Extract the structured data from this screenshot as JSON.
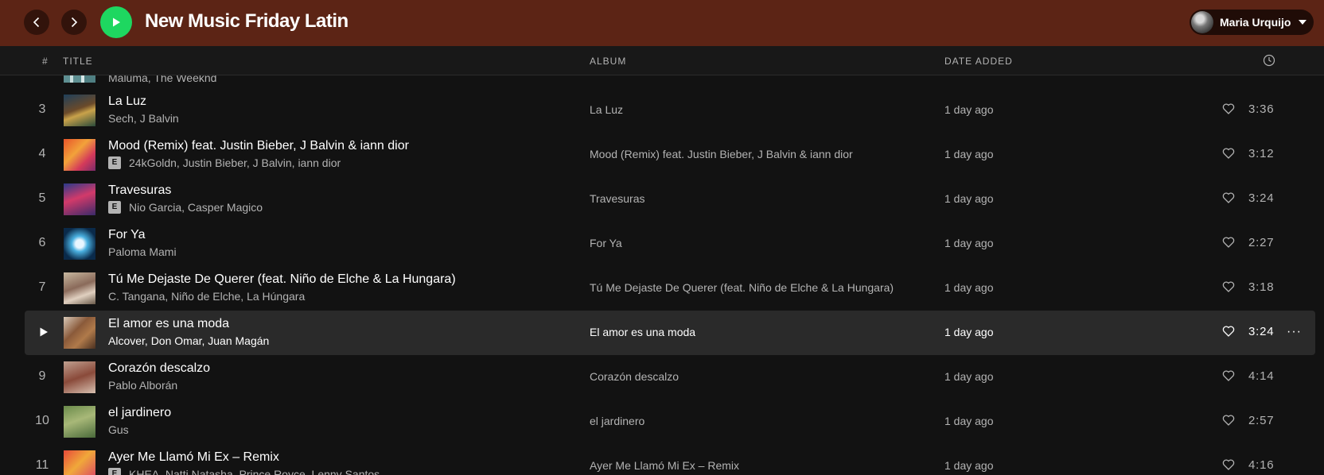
{
  "topbar": {
    "playlist_title": "New Music Friday Latin",
    "user_name": "Maria Urquijo"
  },
  "header": {
    "num": "#",
    "title": "TITLE",
    "album": "ALBUM",
    "date_added": "DATE ADDED"
  },
  "partial_row": {
    "artists": "Maluma, The Weeknd"
  },
  "tracks": [
    {
      "num": "3",
      "title": "La Luz",
      "artists": "Sech, J Balvin",
      "explicit": false,
      "album": "La Luz",
      "date": "1 day ago",
      "duration": "3:36"
    },
    {
      "num": "4",
      "title": "Mood (Remix) feat. Justin Bieber, J Balvin & iann dior",
      "artists": "24kGoldn, Justin Bieber, J Balvin, iann dior",
      "explicit": true,
      "explicit_label": "E",
      "album": "Mood (Remix) feat. Justin Bieber, J Balvin & iann dior",
      "date": "1 day ago",
      "duration": "3:12"
    },
    {
      "num": "5",
      "title": "Travesuras",
      "artists": "Nio Garcia, Casper Magico",
      "explicit": true,
      "explicit_label": "E",
      "album": "Travesuras",
      "date": "1 day ago",
      "duration": "3:24"
    },
    {
      "num": "6",
      "title": "For Ya",
      "artists": "Paloma Mami",
      "explicit": false,
      "album": "For Ya",
      "date": "1 day ago",
      "duration": "2:27"
    },
    {
      "num": "7",
      "title": "Tú Me Dejaste De Querer (feat. Niño de Elche & La Hungara)",
      "artists": "C. Tangana, Niño de Elche, La Húngara",
      "explicit": false,
      "album": "Tú Me Dejaste De Querer (feat. Niño de Elche & La Hungara)",
      "date": "1 day ago",
      "duration": "3:18"
    },
    {
      "num": "8",
      "title": "El amor es una moda",
      "artists": "Alcover, Don Omar, Juan Magán",
      "explicit": false,
      "album": "El amor es una moda",
      "date": "1 day ago",
      "duration": "3:24",
      "hovered": true,
      "more": "···"
    },
    {
      "num": "9",
      "title": "Corazón descalzo",
      "artists": "Pablo Alborán",
      "explicit": false,
      "album": "Corazón descalzo",
      "date": "1 day ago",
      "duration": "4:14"
    },
    {
      "num": "10",
      "title": "el jardinero",
      "artists": "Gus",
      "explicit": false,
      "album": "el jardinero",
      "date": "1 day ago",
      "duration": "2:57"
    },
    {
      "num": "11",
      "title": "Ayer Me Llamó Mi Ex – Remix",
      "artists": "KHEA, Natti Natasha, Prince Royce, Lenny Santos",
      "explicit": true,
      "explicit_label": "E",
      "album": "Ayer Me Llamó Mi Ex – Remix",
      "date": "1 day ago",
      "duration": "4:16"
    }
  ],
  "colors": {
    "topbar_bg": "#5c2415",
    "play_green": "#1ed760",
    "bg": "#121212",
    "row_hover": "#2a2a2a",
    "secondary_text": "#b3b3b3"
  },
  "icons": [
    "chevron-left-icon",
    "chevron-right-icon",
    "play-icon",
    "caret-down-icon",
    "clock-icon",
    "heart-icon",
    "more-icon"
  ]
}
